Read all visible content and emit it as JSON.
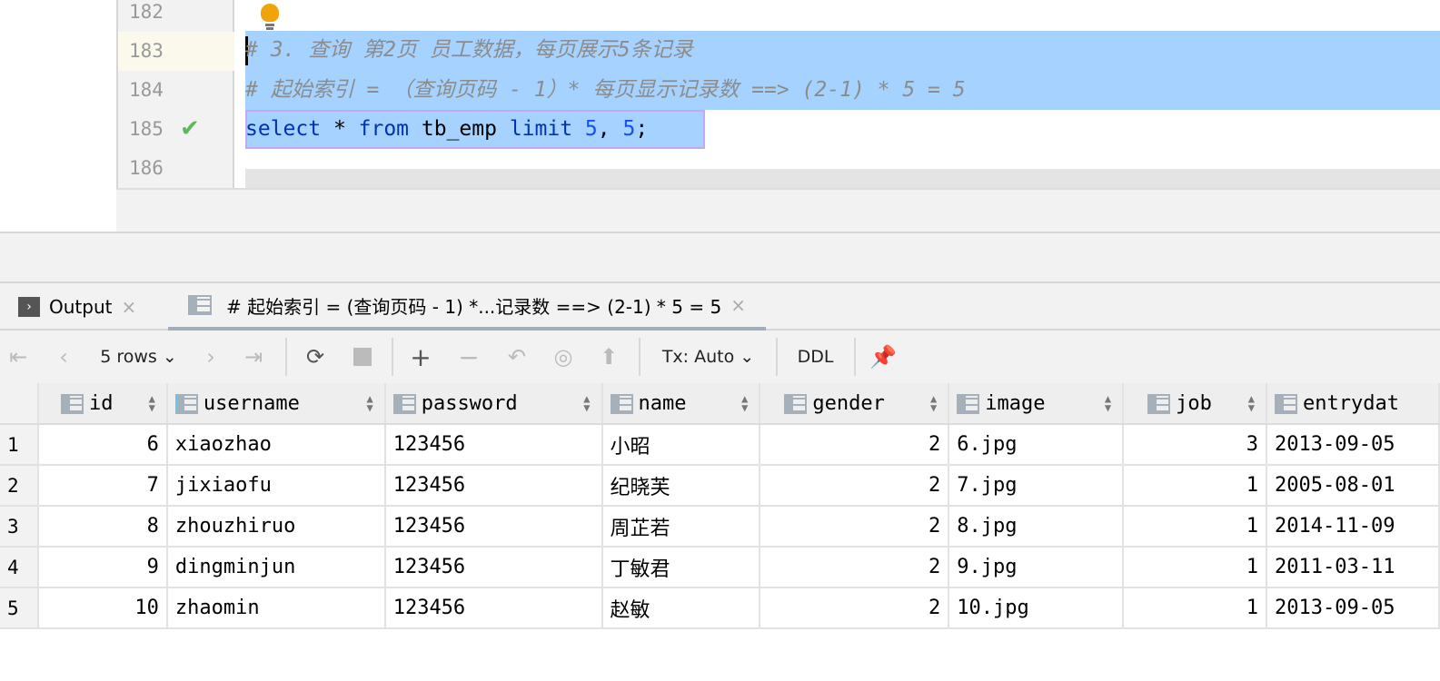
{
  "editor": {
    "lines": [
      {
        "no": "182",
        "text": ""
      },
      {
        "no": "183",
        "text": "# 3. 查询 第2页 员工数据，每页展示5条记录"
      },
      {
        "no": "184",
        "text": "# 起始索引 = （查询页码 - 1）* 每页显示记录数 ==> (2-1) * 5 = 5"
      },
      {
        "no": "185",
        "text": ""
      },
      {
        "no": "186",
        "text": ""
      }
    ],
    "sql": {
      "kw1": "select",
      "star": " * ",
      "kw2": "from",
      "table": " tb_emp ",
      "kw3": "limit",
      "n1": "5",
      "comma": ", ",
      "n2": "5",
      "end": ";"
    }
  },
  "tabs": [
    {
      "label": "Output",
      "close": "×"
    },
    {
      "label": "# 起始索引 =  (查询页码 - 1)  *...记录数 ==> (2-1) * 5 = 5",
      "close": "×"
    }
  ],
  "toolbar": {
    "rows": "5 rows ⌄",
    "tx": "Tx: Auto ⌄",
    "ddl": "DDL"
  },
  "grid": {
    "columns": [
      "id",
      "username",
      "password",
      "name",
      "gender",
      "image",
      "job",
      "entrydat"
    ],
    "rows": [
      [
        "1",
        "6",
        "xiaozhao",
        "123456",
        "小昭",
        "2",
        "6.jpg",
        "3",
        "2013-09-05"
      ],
      [
        "2",
        "7",
        "jixiaofu",
        "123456",
        "纪晓芙",
        "2",
        "7.jpg",
        "1",
        "2005-08-01"
      ],
      [
        "3",
        "8",
        "zhouzhiruo",
        "123456",
        "周芷若",
        "2",
        "8.jpg",
        "1",
        "2014-11-09"
      ],
      [
        "4",
        "9",
        "dingminjun",
        "123456",
        "丁敏君",
        "2",
        "9.jpg",
        "1",
        "2011-03-11"
      ],
      [
        "5",
        "10",
        "zhaomin",
        "123456",
        "赵敏",
        "2",
        "10.jpg",
        "1",
        "2013-09-05"
      ]
    ]
  },
  "colors": {
    "selection": "#a6d2ff",
    "keyword": "#0033b3",
    "number": "#1750eb",
    "comment": "#8c8c8c"
  }
}
